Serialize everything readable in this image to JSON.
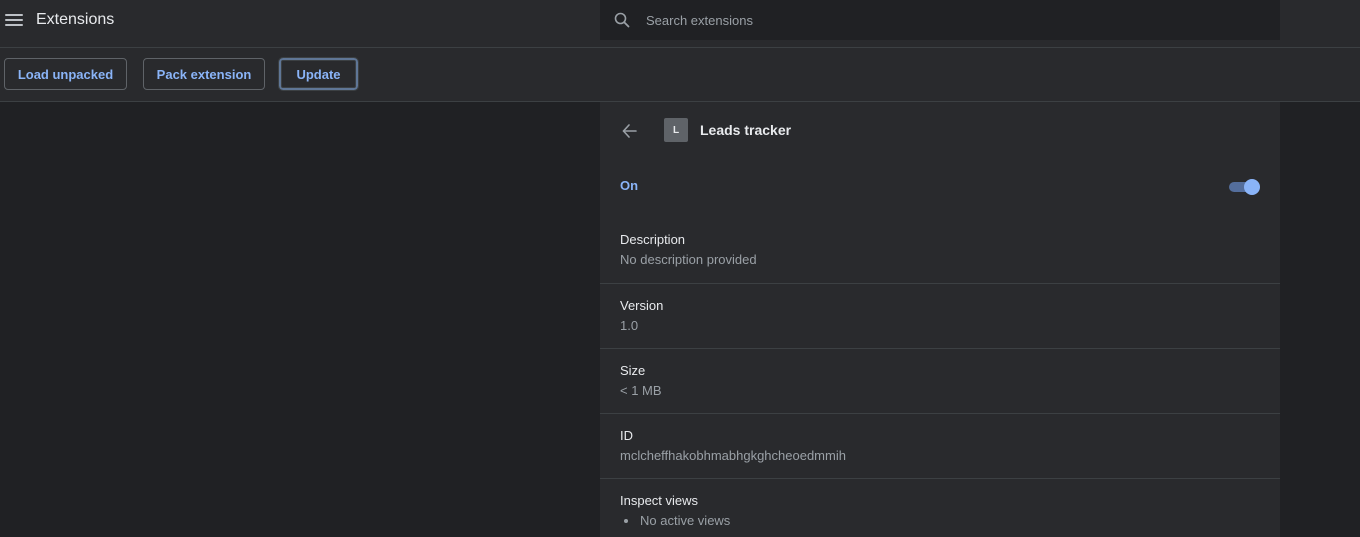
{
  "header": {
    "title": "Extensions",
    "search_placeholder": "Search extensions"
  },
  "toolbar": {
    "load_unpacked": "Load unpacked",
    "pack_extension": "Pack extension",
    "update": "Update"
  },
  "detail": {
    "icon_letter": "L",
    "name": "Leads tracker",
    "status": "On",
    "enabled": true,
    "sections": {
      "description": {
        "label": "Description",
        "value": "No description provided"
      },
      "version": {
        "label": "Version",
        "value": "1.0"
      },
      "size": {
        "label": "Size",
        "value": "< 1 MB"
      },
      "id": {
        "label": "ID",
        "value": "mclcheffhakobhmabhgkghcheoedmmih"
      },
      "inspect_views": {
        "label": "Inspect views",
        "items": [
          "No active views"
        ]
      }
    }
  },
  "colors": {
    "accent": "#8ab4f8",
    "background": "#202124",
    "surface": "#292a2d"
  }
}
